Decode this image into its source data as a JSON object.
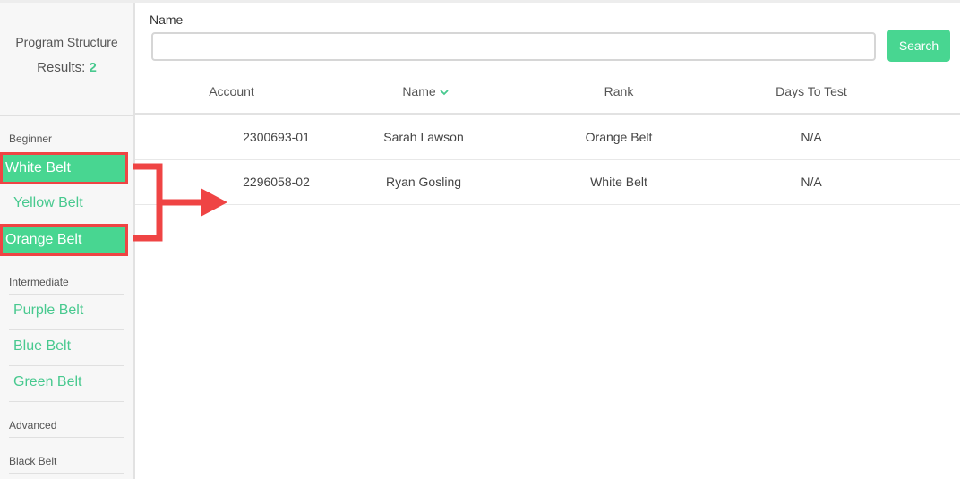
{
  "sidebar": {
    "title": "Program Structure",
    "results_label": "Results:",
    "results_count": "2",
    "groups": [
      {
        "label": "Beginner",
        "items": [
          "White Belt",
          "Yellow Belt",
          "Orange Belt"
        ]
      },
      {
        "label": "Intermediate",
        "items": [
          "Purple Belt",
          "Blue Belt",
          "Green Belt"
        ]
      },
      {
        "label": "Advanced",
        "items": []
      },
      {
        "label": "Black Belt",
        "items": []
      }
    ],
    "highlighted": [
      "White Belt",
      "Orange Belt"
    ]
  },
  "search": {
    "label": "Name",
    "value": "",
    "button_label": "Search"
  },
  "table": {
    "columns": [
      "Account",
      "Name",
      "Rank",
      "Days To Test"
    ],
    "sorted_column": "Name",
    "rows": [
      {
        "account": "2300693-01",
        "name": "Sarah Lawson",
        "rank": "Orange Belt",
        "days_to_test": "N/A"
      },
      {
        "account": "2296058-02",
        "name": "Ryan Gosling",
        "rank": "White Belt",
        "days_to_test": "N/A"
      }
    ]
  },
  "colors": {
    "accent": "#48d691",
    "accent_text": "#48c98f",
    "annotation": "#ef4444"
  },
  "icons": {
    "sort": "chevron-down-icon",
    "annotation": "arrow-right-icon"
  }
}
